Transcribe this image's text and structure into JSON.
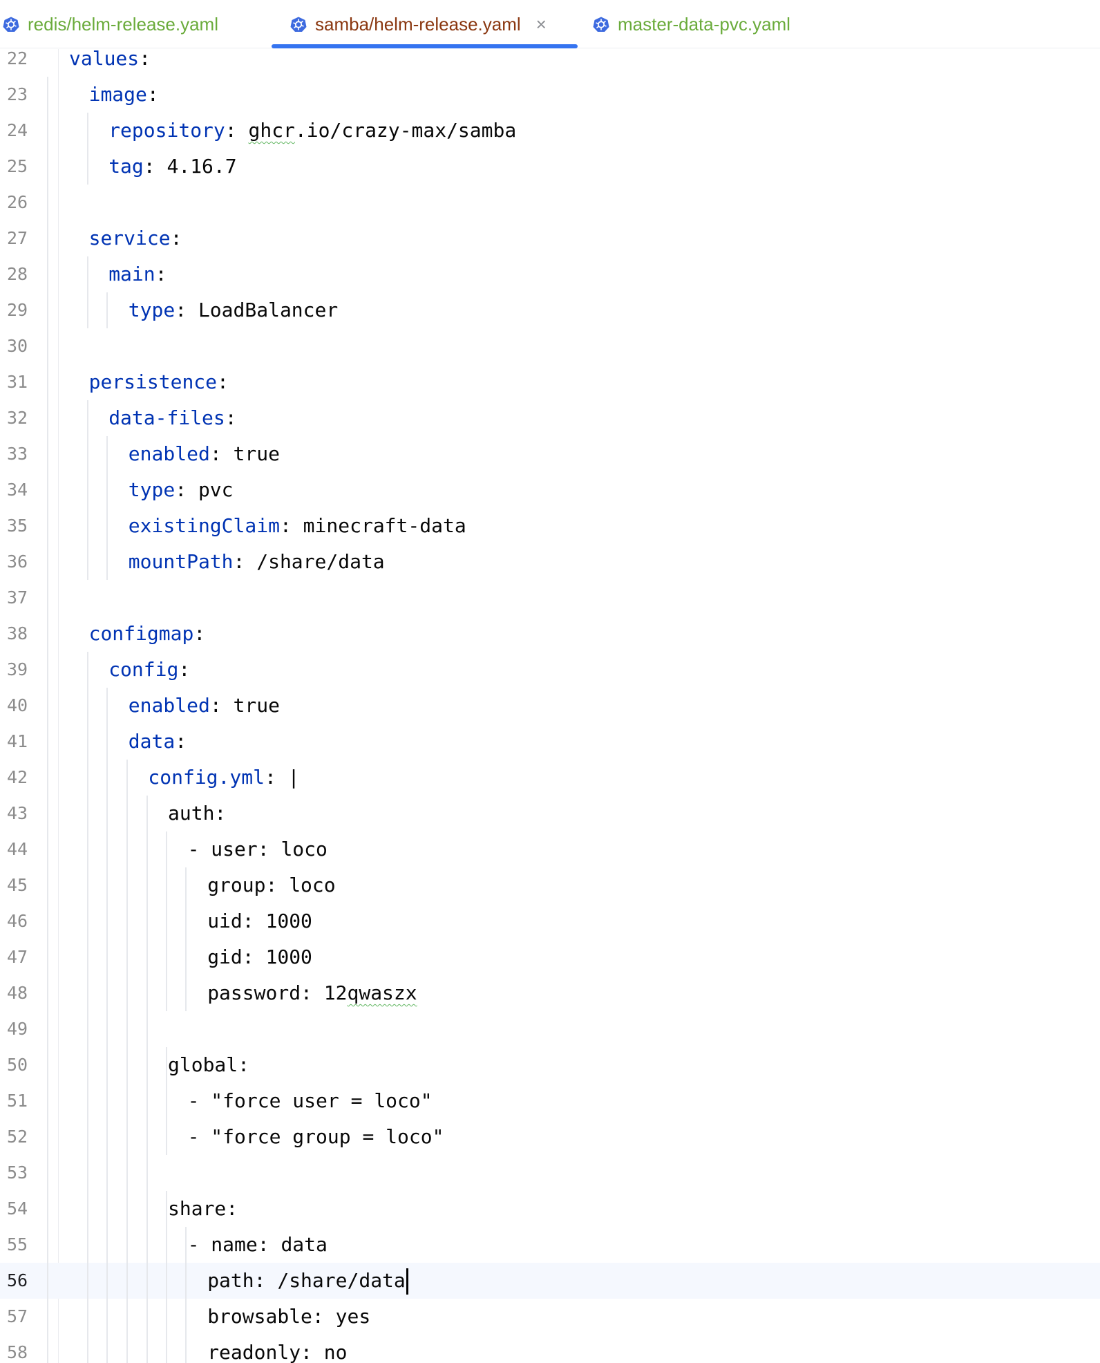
{
  "tabs": [
    {
      "label": "redis/helm-release.yaml",
      "color": "#6aab3b",
      "active": false
    },
    {
      "label": "samba/helm-release.yaml",
      "color": "#8a3710",
      "active": true
    },
    {
      "label": "master-data-pvc.yaml",
      "color": "#6aab3b",
      "active": false
    }
  ],
  "tab_close_glyph": "×",
  "colors": {
    "key": "#0033b3",
    "value": "#080808",
    "gutter": "#8c8c8c",
    "active_tab_underline": "#3574f0",
    "current_line_bg": "#f5f8fe",
    "icon": "#3d6adf"
  },
  "current_line": "56",
  "lines": [
    {
      "n": "22",
      "parts": [
        {
          "k": "values"
        },
        {
          "t": ":"
        }
      ]
    },
    {
      "n": "23",
      "parts": [
        {
          "k": "image"
        },
        {
          "t": ":"
        }
      ]
    },
    {
      "n": "24",
      "parts": [
        {
          "k": "repository"
        },
        {
          "t": ": "
        },
        {
          "w": "ghcr"
        },
        {
          "t": ".io/crazy-max/samba"
        }
      ]
    },
    {
      "n": "25",
      "parts": [
        {
          "k": "tag"
        },
        {
          "t": ": 4.16.7"
        }
      ]
    },
    {
      "n": "26",
      "parts": []
    },
    {
      "n": "27",
      "parts": [
        {
          "k": "service"
        },
        {
          "t": ":"
        }
      ]
    },
    {
      "n": "28",
      "parts": [
        {
          "k": "main"
        },
        {
          "t": ":"
        }
      ]
    },
    {
      "n": "29",
      "parts": [
        {
          "k": "type"
        },
        {
          "t": ": LoadBalancer"
        }
      ]
    },
    {
      "n": "30",
      "parts": []
    },
    {
      "n": "31",
      "parts": [
        {
          "k": "persistence"
        },
        {
          "t": ":"
        }
      ]
    },
    {
      "n": "32",
      "parts": [
        {
          "k": "data-files"
        },
        {
          "t": ":"
        }
      ]
    },
    {
      "n": "33",
      "parts": [
        {
          "k": "enabled"
        },
        {
          "t": ": true"
        }
      ]
    },
    {
      "n": "34",
      "parts": [
        {
          "k": "type"
        },
        {
          "t": ": pvc"
        }
      ]
    },
    {
      "n": "35",
      "parts": [
        {
          "k": "existingClaim"
        },
        {
          "t": ": minecraft-data"
        }
      ]
    },
    {
      "n": "36",
      "parts": [
        {
          "k": "mountPath"
        },
        {
          "t": ": /share/data"
        }
      ]
    },
    {
      "n": "37",
      "parts": []
    },
    {
      "n": "38",
      "parts": [
        {
          "k": "configmap"
        },
        {
          "t": ":"
        }
      ]
    },
    {
      "n": "39",
      "parts": [
        {
          "k": "config"
        },
        {
          "t": ":"
        }
      ]
    },
    {
      "n": "40",
      "parts": [
        {
          "k": "enabled"
        },
        {
          "t": ": true"
        }
      ]
    },
    {
      "n": "41",
      "parts": [
        {
          "k": "data"
        },
        {
          "t": ":"
        }
      ]
    },
    {
      "n": "42",
      "parts": [
        {
          "k": "config.yml"
        },
        {
          "t": ": |"
        }
      ]
    },
    {
      "n": "43",
      "parts": [
        {
          "t": "auth:"
        }
      ]
    },
    {
      "n": "44",
      "parts": [
        {
          "t": "- user: loco"
        }
      ]
    },
    {
      "n": "45",
      "parts": [
        {
          "t": "group: loco"
        }
      ]
    },
    {
      "n": "46",
      "parts": [
        {
          "t": "uid: 1000"
        }
      ]
    },
    {
      "n": "47",
      "parts": [
        {
          "t": "gid: 1000"
        }
      ]
    },
    {
      "n": "48",
      "parts": [
        {
          "t": "password: 12"
        },
        {
          "w": "qwaszx"
        }
      ]
    },
    {
      "n": "49",
      "parts": []
    },
    {
      "n": "50",
      "parts": [
        {
          "t": "global:"
        }
      ]
    },
    {
      "n": "51",
      "parts": [
        {
          "t": "- \"force user = loco\""
        }
      ]
    },
    {
      "n": "52",
      "parts": [
        {
          "t": "- \"force group = loco\""
        }
      ]
    },
    {
      "n": "53",
      "parts": []
    },
    {
      "n": "54",
      "parts": [
        {
          "t": "share:"
        }
      ]
    },
    {
      "n": "55",
      "parts": [
        {
          "t": "- name: data"
        }
      ]
    },
    {
      "n": "56",
      "parts": [
        {
          "t": "path: /share/data"
        }
      ]
    },
    {
      "n": "57",
      "parts": [
        {
          "t": "browsable: yes"
        }
      ]
    },
    {
      "n": "58",
      "parts": [
        {
          "t": "readonly: no"
        }
      ]
    }
  ]
}
